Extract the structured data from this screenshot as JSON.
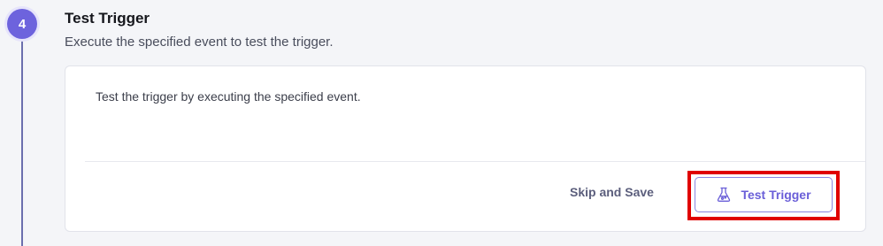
{
  "step": {
    "number": "4",
    "title": "Test Trigger",
    "description": "Execute the specified event to test the trigger."
  },
  "card": {
    "text": "Test the trigger by executing the specified event.",
    "skip_label": "Skip and Save",
    "test_label": "Test Trigger",
    "test_icon": "flask-icon"
  },
  "colors": {
    "accent": "#6d63dd",
    "highlight": "#e00000"
  }
}
